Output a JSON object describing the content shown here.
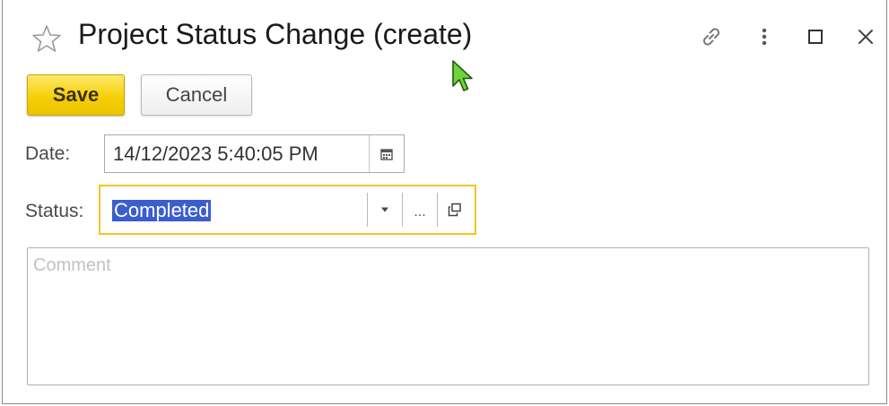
{
  "window": {
    "title": "Project Status Change (create)",
    "icons": [
      "star-icon",
      "link-icon",
      "more-icon",
      "maximize-icon",
      "close-icon"
    ]
  },
  "toolbar": {
    "save_label": "Save",
    "cancel_label": "Cancel"
  },
  "form": {
    "date": {
      "label": "Date:",
      "value": "14/12/2023  5:40:05 PM",
      "icon": "calendar-icon"
    },
    "status": {
      "label": "Status:",
      "value": "Completed",
      "more_label": "...",
      "icons": [
        "dropdown-arrow-icon",
        "open-icon"
      ]
    },
    "comment": {
      "placeholder": "Comment",
      "value": ""
    }
  },
  "colors": {
    "save_button": "#f5cf0a",
    "focus_border": "#f3c323",
    "selection": "#3b5ecf",
    "cursor": "#5cc92a"
  }
}
